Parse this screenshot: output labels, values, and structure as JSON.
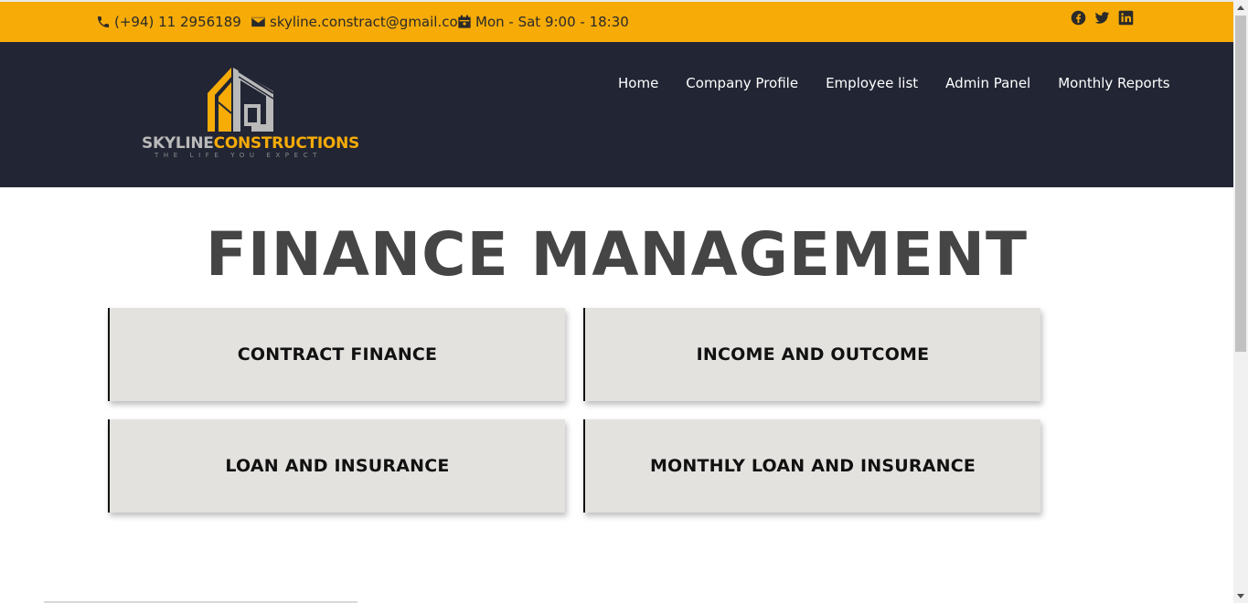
{
  "topbar": {
    "phone": "(+94) 11 2956189",
    "email": "skyline.constract@gmail.com",
    "hours": "Mon - Sat 9:00 - 18:30",
    "phone_icon": "phone-icon",
    "email_icon": "envelope-icon",
    "hours_icon": "calendar-icon",
    "socials": [
      "facebook-icon",
      "twitter-icon",
      "linkedin-icon"
    ],
    "background": "#f6ab07"
  },
  "header": {
    "background": "#222534",
    "logo": {
      "name_part1": "SKYLINE",
      "name_part2": "CONSTRUCTIONS",
      "tagline": "THE LIFE YOU EXPECT"
    },
    "nav": [
      "Home",
      "Company Profile",
      "Employee list",
      "Admin Panel",
      "Monthly Reports"
    ]
  },
  "main": {
    "title": "FINANCE MANAGEMENT",
    "cards": [
      "CONTRACT FINANCE",
      "INCOME AND OUTCOME",
      "LOAN AND INSURANCE",
      "MONTHLY LOAN AND INSURANCE"
    ]
  }
}
